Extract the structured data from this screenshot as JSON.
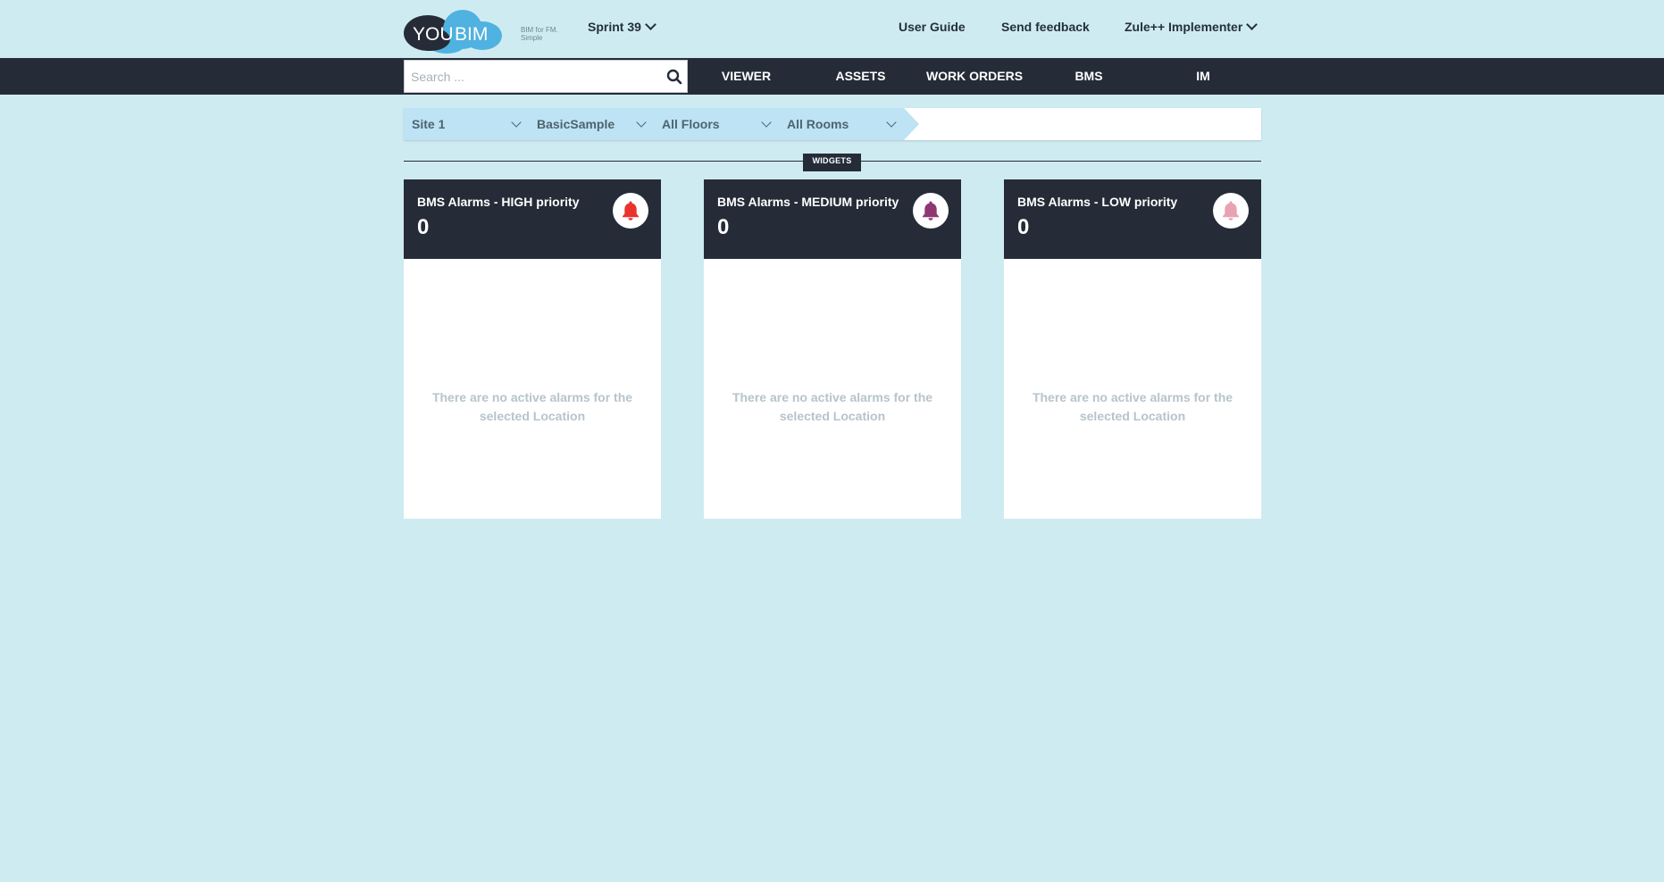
{
  "header": {
    "logo_left": "YOU",
    "logo_right": "BIM",
    "tagline_line1": "BIM for FM.",
    "tagline_line2": "Simple",
    "project": "Sprint 39",
    "user_guide": "User Guide",
    "send_feedback": "Send feedback",
    "user": "Zule++ Implementer"
  },
  "search": {
    "placeholder": "Search ..."
  },
  "nav": {
    "items": [
      {
        "label": "VIEWER"
      },
      {
        "label": "ASSETS"
      },
      {
        "label": "WORK ORDERS"
      },
      {
        "label": "BMS"
      },
      {
        "label": "IM"
      }
    ]
  },
  "filters": {
    "site": "Site 1",
    "building": "BasicSample",
    "floors": "All Floors",
    "rooms": "All Rooms"
  },
  "widgets_label": "WIDGETS",
  "widgets": [
    {
      "title": "BMS Alarms - HIGH priority",
      "count": "0",
      "empty_message": "There are no active alarms for the selected Location",
      "bell_color": "#e8342c",
      "icon": "bell-icon"
    },
    {
      "title": "BMS Alarms - MEDIUM priority",
      "count": "0",
      "empty_message": "There are no active alarms for the selected Location",
      "bell_color": "#8e3772",
      "icon": "bell-icon"
    },
    {
      "title": "BMS Alarms - LOW priority",
      "count": "0",
      "empty_message": "There are no active alarms for the selected Location",
      "bell_color": "#e8a3b2",
      "icon": "bell-icon"
    }
  ],
  "colors": {
    "background": "#cfebf2",
    "dark": "#252c38",
    "breadcrumb_fill": "#bde3f4",
    "logo_dark": "#252c38",
    "logo_light": "#4fb2e0"
  }
}
